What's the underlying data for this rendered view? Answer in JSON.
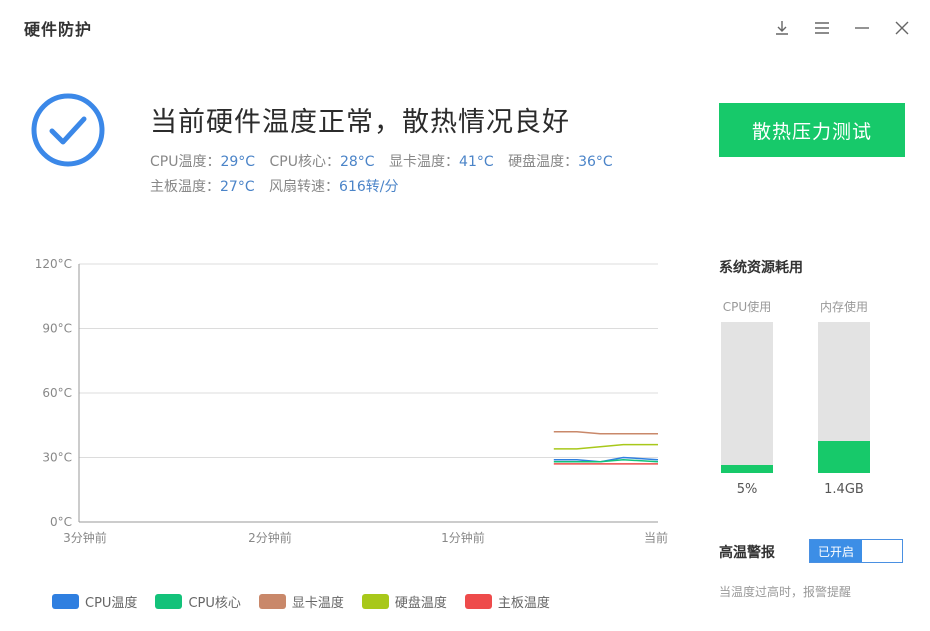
{
  "app": {
    "title": "硬件防护"
  },
  "window_controls": [
    {
      "icon": "download-icon"
    },
    {
      "icon": "menu-icon"
    },
    {
      "icon": "minimize-icon"
    },
    {
      "icon": "close-icon"
    }
  ],
  "status": {
    "headline": "当前硬件温度正常，散热情况良好",
    "readings_line1": [
      {
        "label": "CPU温度：",
        "value": "29°C"
      },
      {
        "label": "CPU核心：",
        "value": "28°C"
      },
      {
        "label": "显卡温度：",
        "value": "41°C"
      },
      {
        "label": "硬盘温度：",
        "value": "36°C"
      }
    ],
    "readings_line2": [
      {
        "label": "主板温度：",
        "value": "27°C"
      },
      {
        "label": "风扇转速：",
        "value": "616转/分"
      }
    ]
  },
  "stress_test_button": "散热压力测试",
  "chart_data": {
    "type": "line",
    "y_ticks": [
      "120°C",
      "90°C",
      "60°C",
      "30°C",
      "0°C"
    ],
    "ylim": [
      0,
      120
    ],
    "x_ticks": [
      "3分钟前",
      "2分钟前",
      "1分钟前",
      "当前"
    ],
    "x": [
      0.82,
      0.86,
      0.9,
      0.94,
      1.0
    ],
    "series": [
      {
        "name": "CPU温度",
        "color": "#2f7fe0",
        "values": [
          29,
          29,
          28,
          30,
          29
        ]
      },
      {
        "name": "CPU核心",
        "color": "#13c27a",
        "values": [
          28,
          28,
          28,
          29,
          28
        ]
      },
      {
        "name": "显卡温度",
        "color": "#c9886a",
        "values": [
          42,
          42,
          41,
          41,
          41
        ]
      },
      {
        "name": "硬盘温度",
        "color": "#a8c81a",
        "values": [
          34,
          34,
          35,
          36,
          36
        ]
      },
      {
        "name": "主板温度",
        "color": "#ee4b4b",
        "values": [
          27,
          27,
          27,
          27,
          27
        ]
      }
    ]
  },
  "resources": {
    "title": "系统资源耗用",
    "cpu": {
      "label": "CPU使用",
      "value": "5%",
      "level": 0.05
    },
    "memory": {
      "label": "内存使用",
      "value": "1.4GB",
      "level": 0.21
    }
  },
  "alarm": {
    "label": "高温警报",
    "toggle_text": "已开启",
    "note": "当温度过高时，报警提醒"
  },
  "colors": {
    "accent_green": "#17c96a",
    "accent_blue": "#4a90e2"
  }
}
